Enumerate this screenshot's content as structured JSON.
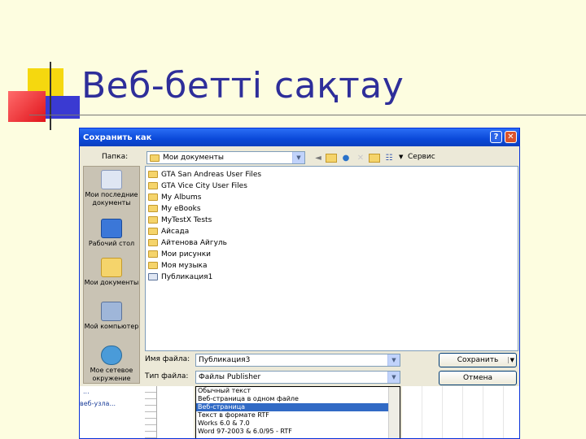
{
  "slide": {
    "title": "Веб-бетті сақтау"
  },
  "dialog": {
    "title": "Сохранить как",
    "help_label": "?",
    "close_label": "✕",
    "lookin_label": "Папка:",
    "lookin_value": "Мои документы",
    "tools_label": "Сервис",
    "places": [
      {
        "label": "Мои последние документы",
        "icon": "recent-docs-icon"
      },
      {
        "label": "Рабочий стол",
        "icon": "desktop-icon"
      },
      {
        "label": "Мои документы",
        "icon": "my-documents-icon"
      },
      {
        "label": "Мой компьютер",
        "icon": "my-computer-icon"
      },
      {
        "label": "Мое сетевое окружение",
        "icon": "network-icon"
      }
    ],
    "files": [
      "GTA San Andreas User Files",
      "GTA Vice City User Files",
      "My Albums",
      "My eBooks",
      "MyTestX Tests",
      "Айсада",
      "Айтенова Айгуль",
      "Мои рисунки",
      "Моя музыка",
      "Публикация1"
    ],
    "filename_label": "Имя файла:",
    "filename_value": "Публикация3",
    "filetype_label": "Тип файла:",
    "filetype_value": "Файлы Publisher",
    "save_label": "Сохранить",
    "cancel_label": "Отмена",
    "filetype_options": [
      "Обычный текст",
      "Веб-страница в одном файле",
      "Веб-страница",
      "Текст в формате RTF",
      "Works 6.0 & 7.0",
      "Word 97-2003 & 6.0/95 - RTF"
    ],
    "selected_option_index": 2
  },
  "background": {
    "left_text_1": "...",
    "left_text_2": "веб-узла..."
  },
  "colors": {
    "slide_bg": "#fdfde0",
    "title": "#2e2e9a",
    "titlebar": "#0a48d8",
    "selection": "#316ac5"
  }
}
